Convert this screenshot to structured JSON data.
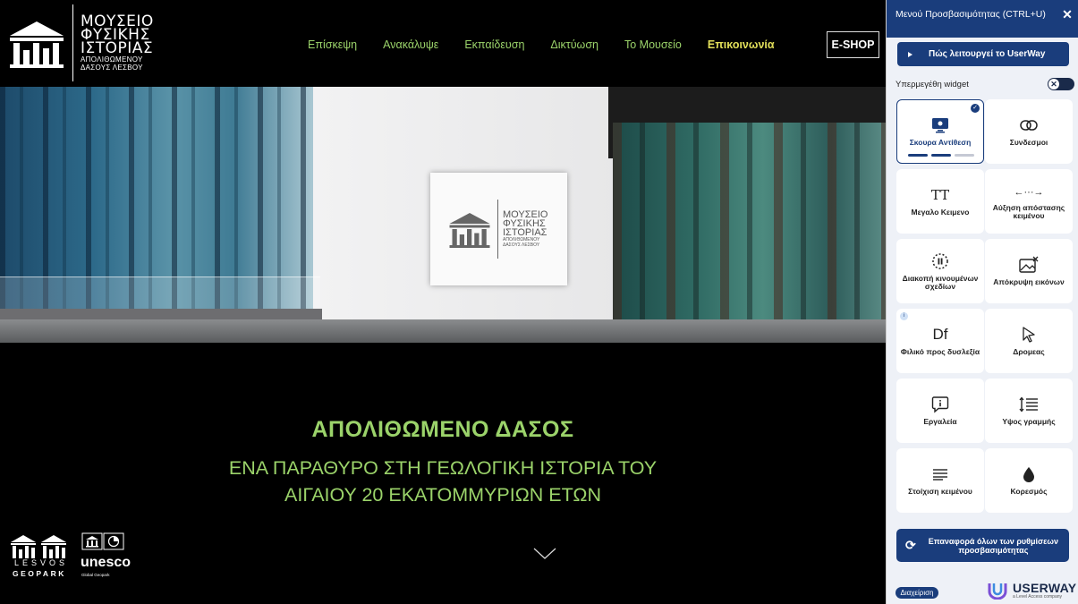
{
  "logo": {
    "line1": "ΜΟΥΣΕΙΟ",
    "line2": "ΦΥΣΙΚΗΣ",
    "line3": "ΙΣΤΟΡΙΑΣ",
    "line4": "ΑΠΟΛΙΘΩΜΕΝΟΥ",
    "line5": "ΔΑΣΟΥΣ ΛΕΣΒΟΥ"
  },
  "nav": {
    "items": [
      "Επίσκεψη",
      "Ανακάλυψε",
      "Εκπαίδευση",
      "Δικτύωση",
      "Το Μουσείο"
    ],
    "active": "Επικοινωνία",
    "eshop": "E-SHOP"
  },
  "hero": {
    "title": "ΑΠΟΛΙΘΩΜΕΝΟ ΔΑΣΟΣ",
    "subtitle_line1": "ΕΝΑ ΠΑΡΑΘΥΡΟ ΣΤΗ ΓΕΩΛΟΓΙΚΗ ΙΣΤΟΡΙΑ ΤΟΥ",
    "subtitle_line2": "ΑΙΓΑΙΟΥ 20 ΕΚΑΤΟΜΜΥΡΙΩΝ ΕΤΩΝ",
    "sign": {
      "line1": "ΜΟΥΣΕΙΟ",
      "line2": "ΦΥΣΙΚΗΣ",
      "line3": "ΙΣΤΟΡΙΑΣ",
      "line4": "ΑΠΟΛΙΘΩΜΕΝΟΥ",
      "line5": "ΔΑΣΟΥΣ ΛΕΣΒΟΥ"
    }
  },
  "bottom_logos": {
    "lesvos": "LESVOS",
    "geopark": "GEOPARK",
    "unesco": "unesco",
    "global": "Global Geopark"
  },
  "accessibility": {
    "title": "Μενού Προσβασιμότητας (CTRL+U)",
    "close": "✕",
    "how_it_works": "Πώς λειτουργεί το UserWay",
    "oversize_label": "Υπερμεγέθη widget",
    "toggle_knob": "✕",
    "tiles": [
      {
        "label": "Σκουρα Αντίθεση",
        "icon": "monitor-icon",
        "active": true
      },
      {
        "label": "Συνδεσμοι",
        "icon": "link-icon"
      },
      {
        "label": "Μεγαλο Κειμενο",
        "icon": "text-size-icon",
        "glyph": "TT"
      },
      {
        "label": "Αύξηση απόστασης κειμένου",
        "icon": "text-spacing-icon",
        "glyph": "←···→"
      },
      {
        "label": "Διακοπή κινουμένων σχεδίων",
        "icon": "pause-animation-icon"
      },
      {
        "label": "Απόκρυψη εικόνων",
        "icon": "hide-images-icon"
      },
      {
        "label": "Φιλικό προς δυσλεξία",
        "icon": "dyslexia-icon",
        "glyph": "Df"
      },
      {
        "label": "Δρομεας",
        "icon": "cursor-icon"
      },
      {
        "label": "Εργαλεία",
        "icon": "tools-icon"
      },
      {
        "label": "Υψος γραμμής",
        "icon": "line-height-icon"
      },
      {
        "label": "Στοίχιση κειμένου",
        "icon": "text-align-icon"
      },
      {
        "label": "Κορεσμός",
        "icon": "saturation-icon"
      }
    ],
    "reset": "Επαναφορά όλων των ρυθμίσεων προσβασιμότητας",
    "manage": "Διαχείριση",
    "brand": "USERWAY",
    "brand_tag": "a Level Access company"
  },
  "colors": {
    "accent_green": "#9bd36a",
    "active_yellow": "#e3e05a",
    "panel_blue": "#1a3d7c"
  }
}
